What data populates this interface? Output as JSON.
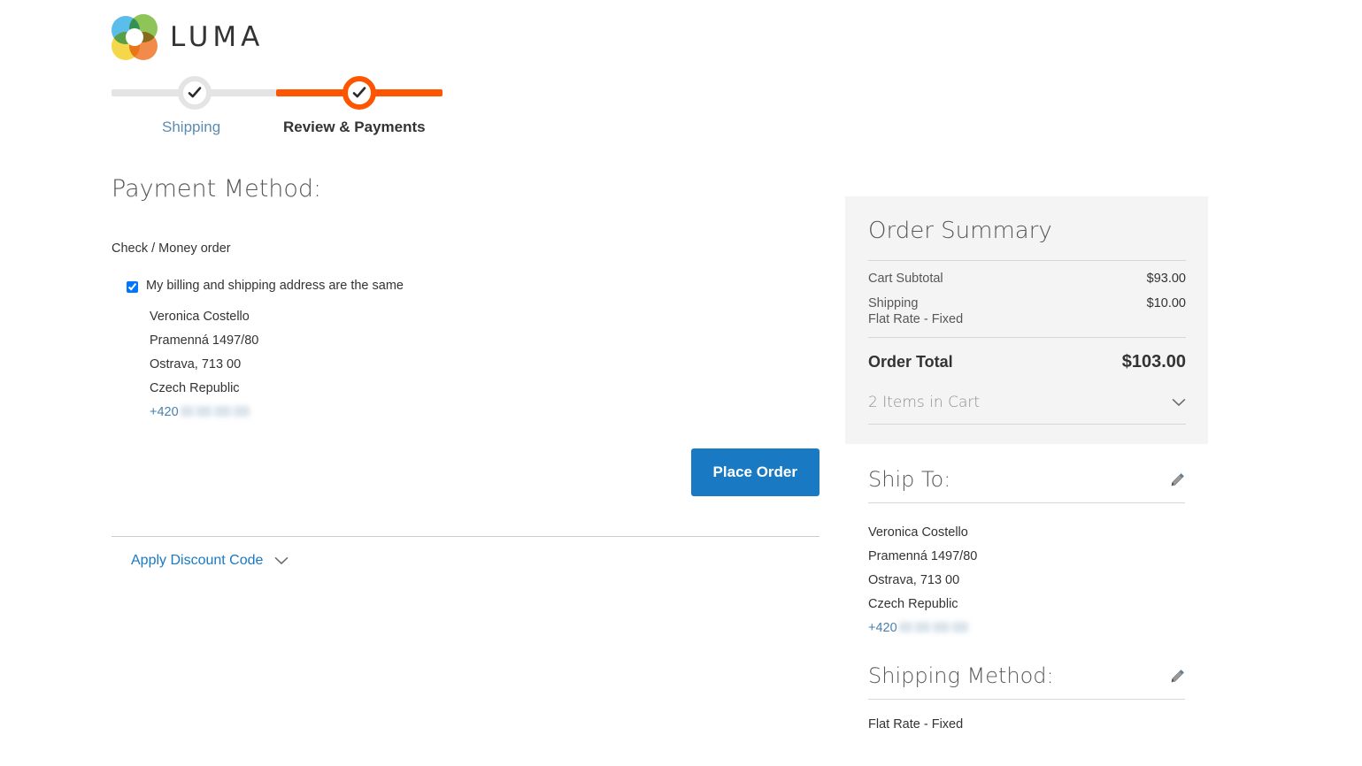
{
  "brand": {
    "name": "LUMA",
    "logo_icon": "luma-rings-logo"
  },
  "progress": {
    "steps": [
      {
        "label": "Shipping",
        "state": "completed",
        "icon": "check-icon"
      },
      {
        "label": "Review & Payments",
        "state": "active",
        "icon": "check-icon"
      }
    ]
  },
  "main": {
    "title": "Payment Method:",
    "payment_method_name": "Check / Money order",
    "billing_checkbox": {
      "label": "My billing and shipping address are the same",
      "checked": true
    },
    "billing_address": {
      "name": "Veronica Costello",
      "street": "Pramenná 1497/80",
      "city_zip": "Ostrava, 713 00",
      "country": "Czech Republic",
      "phone": "+420"
    },
    "place_order_label": "Place Order",
    "discount": {
      "label": "Apply Discount Code",
      "icon": "chevron-down-icon",
      "expanded": false
    }
  },
  "summary": {
    "title": "Order Summary",
    "rows": [
      {
        "label": "Cart Subtotal",
        "value": "$93.00",
        "sub": ""
      },
      {
        "label": "Shipping",
        "value": "$10.00",
        "sub": "Flat Rate - Fixed"
      }
    ],
    "total_label": "Order Total",
    "total_value": "$103.00",
    "items_label": "2 Items in Cart",
    "items_icon": "chevron-down-icon"
  },
  "ship_to": {
    "title": "Ship To:",
    "edit_icon": "pencil-icon",
    "address": {
      "name": "Veronica Costello",
      "street": "Pramenná 1497/80",
      "city_zip": "Ostrava, 713 00",
      "country": "Czech Republic",
      "phone": "+420"
    }
  },
  "shipping_method": {
    "title": "Shipping Method:",
    "edit_icon": "pencil-icon",
    "value": "Flat Rate - Fixed"
  },
  "colors": {
    "accent_orange": "#ff5501",
    "link_blue": "#1979c3",
    "button_blue": "#1979c3",
    "panel_gray": "#f4f4f4",
    "text_dark": "#333333"
  }
}
